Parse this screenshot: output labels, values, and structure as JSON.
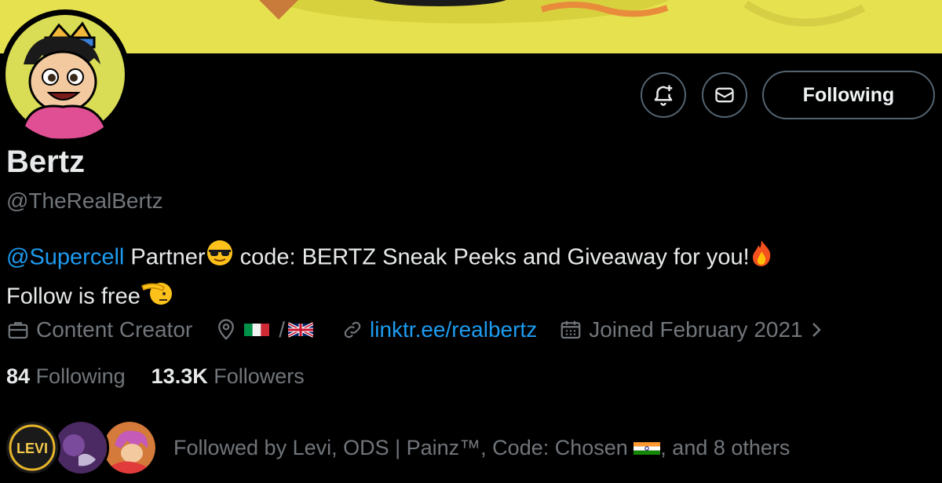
{
  "profile": {
    "name": "Bertz",
    "handle": "@TheRealBertz",
    "bio": {
      "mention": "@Supercell",
      "line1_rest": " Partner",
      "line1_after_emoji": " code: BERTZ Sneak Peeks and Giveaway for you!",
      "line2": "Follow is free"
    },
    "meta": {
      "category": "Content Creator",
      "location_separator": "/",
      "website": "linktr.ee/realbertz",
      "joined": "Joined February 2021"
    },
    "stats": {
      "following_count": "84",
      "following_label": "Following",
      "followers_count": "13.3K",
      "followers_label": "Followers"
    },
    "followed_by": {
      "prefix": "Followed by Levi, ODS | Painz™, Code: Chosen ",
      "suffix": ", and 8 others",
      "first_avatar_label": "LEVI"
    }
  },
  "actions": {
    "follow_label": "Following"
  },
  "colors": {
    "banner": "#e6e24f",
    "link": "#1d9bf0",
    "muted": "#71767b",
    "text": "#e7e9ea"
  }
}
